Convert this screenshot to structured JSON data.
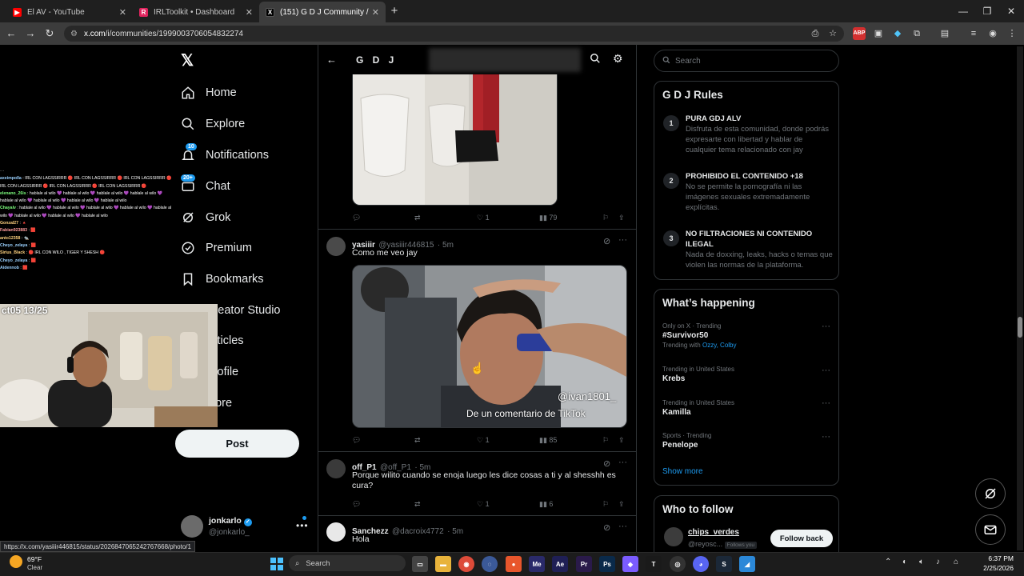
{
  "browser": {
    "tabs": [
      {
        "title": "El AV - YouTube",
        "favicon_color": "#ff0000"
      },
      {
        "title": "IRLToolkit • Dashboard",
        "favicon_color": "#e0245e"
      },
      {
        "title": "(151) G D J Community / X",
        "favicon_color": "#000000"
      }
    ],
    "url_host": "x.com",
    "url_path": "/i/communities/1999003706054832274",
    "status_url": "https://x.com/yasiiir446815/status/2026847065242767668/photo/1"
  },
  "nav": {
    "items": [
      {
        "label": "Home",
        "icon": "home-icon"
      },
      {
        "label": "Explore",
        "icon": "search-icon"
      },
      {
        "label": "Notifications",
        "icon": "bell-icon",
        "badge": "10"
      },
      {
        "label": "Chat",
        "icon": "mail-icon",
        "badge": "20+"
      },
      {
        "label": "Grok",
        "icon": "grok-icon"
      },
      {
        "label": "Premium",
        "icon": "premium-icon"
      },
      {
        "label": "Bookmarks",
        "icon": "bookmark-icon"
      },
      {
        "label": "Creator Studio",
        "icon": "studio-icon"
      },
      {
        "label": "Articles",
        "icon": "article-icon"
      },
      {
        "label": "Profile",
        "icon": "profile-icon"
      },
      {
        "label": "More",
        "icon": "more-icon"
      }
    ],
    "post_label": "Post",
    "account": {
      "name": "jonkarlo",
      "handle": "@jonkarlo_"
    }
  },
  "overlay": {
    "cam_text": "ct05 13/25",
    "chat": [
      {
        "user": "axeimpolla",
        "msg": ": IRL CON LAGSSIRRR 🔴 IRL CON LAGSSIRRR 🔴 IRL CON LAGSSIRRR 🔴 IRL CON LAGSSIRRR 🔴 IRL CON LAGSSIRRR 🔴 IRL CON LAGSSIRRR 🔴",
        "color": "#9ad1ff"
      },
      {
        "user": "elenano_26is",
        "msg": ": hablale al wilo 💜 hablale al wilo 💜 hablale al wilo 💜 hablale al wilo 💜 hablale al wilo 💜 hablale al wilo 💜 hablale al wilo 💜 hablale al wilo",
        "color": "#7cfc7c"
      },
      {
        "user": "Chayalv",
        "msg": ": hablale al wilo 💜 hablale al wilo 💜 hablale al wilo 💜 hablale al wilo 💜 hablale al wilo 💜 hablale al wilo 💜 hablale al wilo 💜 hablale al wilo",
        "color": "#7cfc7c"
      },
      {
        "user": "Gonzal27",
        "msg": ": 🔺",
        "color": "#ffd27f"
      },
      {
        "user": "Fabian923883",
        "msg": ": 🟥",
        "color": "#ff9b9b"
      },
      {
        "user": "anto12358",
        "msg": ": 🐀",
        "color": "#ffd27f"
      },
      {
        "user": "Cheyo_zelaya",
        "msg": ": 🟥",
        "color": "#9ad1ff"
      },
      {
        "user": "Sirius_Black",
        "msg": ": 🔴 IRL CON WILO , TIGER Y SHESH 🔴",
        "color": "#ffd27f"
      },
      {
        "user": "Cheyo_zelaya",
        "msg": ": 🟥",
        "color": "#9ad1ff"
      },
      {
        "user": "Aidennob",
        "msg": ": 🟥",
        "color": "#9ad1ff"
      }
    ]
  },
  "community": {
    "title": "G D J",
    "posts": [
      {
        "stats": {
          "replies": "",
          "reposts": "",
          "likes": "1",
          "views": "79"
        }
      },
      {
        "name": "yasiiir",
        "handle": "@yasiiir446815",
        "time": "· 5m",
        "text": "Como me veo jay",
        "watermark_user": "@ivan1801_",
        "caption": "De un comentario de TikTok",
        "stats": {
          "replies": "",
          "reposts": "",
          "likes": "1",
          "views": "85"
        }
      },
      {
        "name": "off_P1",
        "handle": "@off_P1",
        "time": "· 5m",
        "text": "Porque wilito cuando se enoja luego les dice cosas a ti y al shesshh es cura?",
        "stats": {
          "replies": "",
          "reposts": "",
          "likes": "1",
          "views": "6"
        }
      },
      {
        "name": "Sanchezz",
        "handle": "@dacroix4772",
        "time": "· 5m",
        "text": "Hola"
      }
    ]
  },
  "sidebar": {
    "search_placeholder": "Search",
    "rules_title": "G D J Rules",
    "rules": [
      {
        "num": "1",
        "title": "PURA GDJ ALV",
        "desc": "Disfruta de esta comunidad, donde podrás expresarte con libertad y hablar de cualquier tema relacionado con jay"
      },
      {
        "num": "2",
        "title": "PROHIBIDO EL CONTENIDO +18",
        "desc": "No se permite la pornografía ni las imágenes sexuales extremadamente explícitas."
      },
      {
        "num": "3",
        "title": "NO FILTRACIONES NI CONTENIDO ILEGAL",
        "desc": "Nada de doxxing, leaks, hacks o temas que violen las normas de la plataforma."
      }
    ],
    "happening_title": "What’s happening",
    "trends": [
      {
        "meta": "Only on X · Trending",
        "name": "#Survivor50",
        "with_label": "Trending with",
        "with": "Ozzy, Colby"
      },
      {
        "meta": "Trending in United States",
        "name": "Krebs"
      },
      {
        "meta": "Trending in United States",
        "name": "Kamilla"
      },
      {
        "meta": "Sports · Trending",
        "name": "Penelope"
      }
    ],
    "show_more": "Show more",
    "follow_title": "Who to follow",
    "follow": {
      "name": "chips_verdes",
      "handle": "@reyosc...",
      "tag": "Follows you",
      "button": "Follow back"
    }
  },
  "taskbar": {
    "weather_temp": "69°F",
    "weather_desc": "Clear",
    "search_label": "Search",
    "time": "6:37 PM",
    "date": "2/25/2026"
  }
}
